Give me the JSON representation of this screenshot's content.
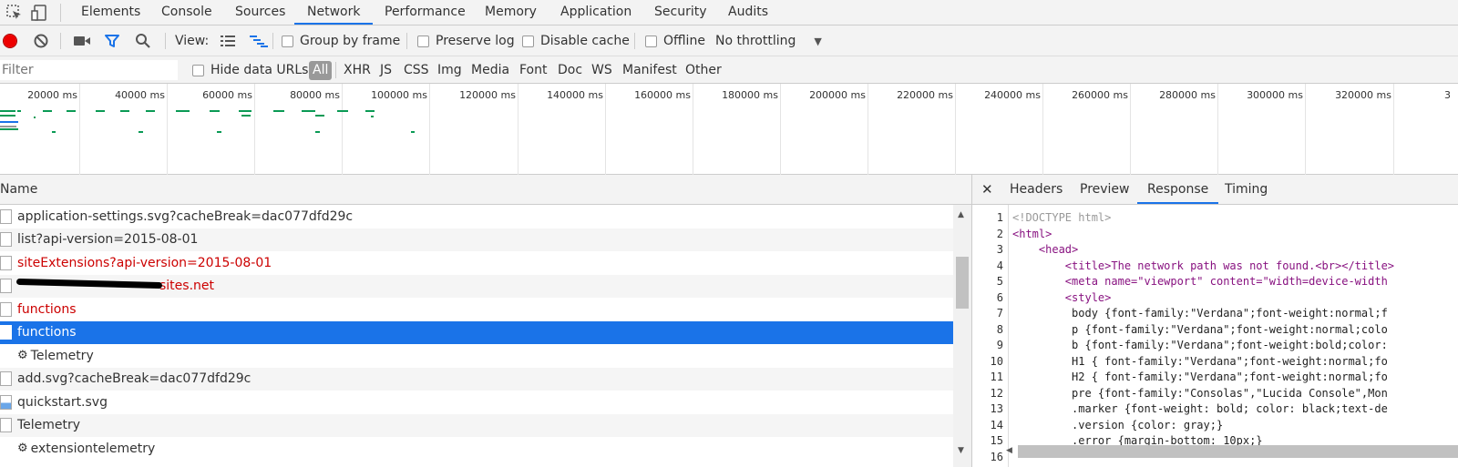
{
  "tabs": [
    {
      "label": "Elements"
    },
    {
      "label": "Console"
    },
    {
      "label": "Sources"
    },
    {
      "label": "Network",
      "active": true
    },
    {
      "label": "Performance"
    },
    {
      "label": "Memory"
    },
    {
      "label": "Application"
    },
    {
      "label": "Security"
    },
    {
      "label": "Audits"
    }
  ],
  "toolbar": {
    "view_label": "View:",
    "group_by_frame": "Group by frame",
    "preserve_log": "Preserve log",
    "disable_cache": "Disable cache",
    "offline": "Offline",
    "throttling": "No throttling"
  },
  "filterbar": {
    "placeholder": "Filter",
    "hide_data_urls": "Hide data URLs",
    "types": [
      "All",
      "XHR",
      "JS",
      "CSS",
      "Img",
      "Media",
      "Font",
      "Doc",
      "WS",
      "Manifest",
      "Other"
    ]
  },
  "overview": {
    "ticks": [
      "20000 ms",
      "40000 ms",
      "60000 ms",
      "80000 ms",
      "100000 ms",
      "120000 ms",
      "140000 ms",
      "160000 ms",
      "180000 ms",
      "200000 ms",
      "220000 ms",
      "240000 ms",
      "260000 ms",
      "280000 ms",
      "300000 ms",
      "320000 ms",
      "3"
    ]
  },
  "requests": {
    "column_name": "Name",
    "rows": [
      {
        "name": "application-settings.svg?cacheBreak=dac077dfd29c",
        "type": "file"
      },
      {
        "name": "list?api-version=2015-08-01",
        "type": "file"
      },
      {
        "name": "siteExtensions?api-version=2015-08-01",
        "type": "file",
        "error": true
      },
      {
        "name": "sites.net",
        "type": "file",
        "error": true,
        "redacted": true
      },
      {
        "name": "functions",
        "type": "file",
        "error": true
      },
      {
        "name": "functions",
        "type": "file",
        "selected": true
      },
      {
        "name": "Telemetry",
        "type": "gear"
      },
      {
        "name": "add.svg?cacheBreak=dac077dfd29c",
        "type": "file"
      },
      {
        "name": "quickstart.svg",
        "type": "image"
      },
      {
        "name": "Telemetry",
        "type": "file"
      },
      {
        "name": "extensiontelemetry",
        "type": "gear"
      }
    ]
  },
  "detail": {
    "tabs": [
      {
        "label": "Headers"
      },
      {
        "label": "Preview"
      },
      {
        "label": "Response",
        "active": true
      },
      {
        "label": "Timing"
      }
    ],
    "line_numbers": [
      "1",
      "2",
      "3",
      "4",
      "5",
      "6",
      "7",
      "8",
      "9",
      "10",
      "11",
      "12",
      "13",
      "14",
      "15",
      "16"
    ],
    "code": [
      "<!DOCTYPE html>",
      "<html>",
      "    <head>",
      "        <title>The network path was not found.<br></title>",
      "        <meta name=\"viewport\" content=\"width=device-width",
      "        <style>",
      "         body {font-family:\"Verdana\";font-weight:normal;f",
      "         p {font-family:\"Verdana\";font-weight:normal;colo",
      "         b {font-family:\"Verdana\";font-weight:bold;color:",
      "         H1 { font-family:\"Verdana\";font-weight:normal;fo",
      "         H2 { font-family:\"Verdana\";font-weight:normal;fo",
      "         pre {font-family:\"Consolas\",\"Lucida Console\",Mon",
      "         .marker {font-weight: bold; color: black;text-de",
      "         .version {color: gray;}",
      "         .error {margin-bottom: 10px;}",
      ""
    ]
  }
}
